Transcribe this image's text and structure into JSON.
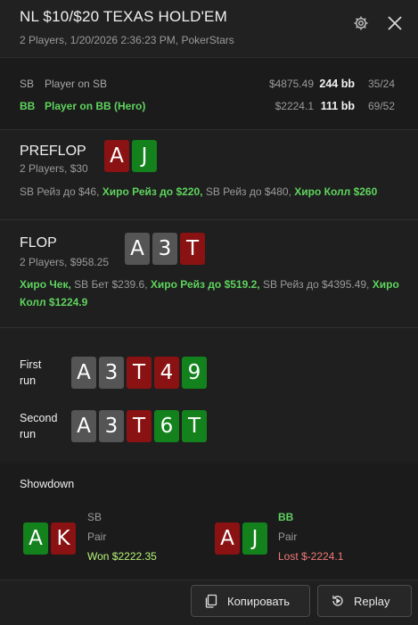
{
  "header": {
    "title": "NL $10/$20 TEXAS HOLD'EM",
    "subtitle": "2 Players, 1/20/2026 2:36:23 PM, PokerStars",
    "icons": [
      "gear-icon",
      "close-icon"
    ]
  },
  "players": [
    {
      "pos": "SB",
      "name": "Player on SB",
      "stack": "$4875.49",
      "bb": "244 bb",
      "stat": "35/24",
      "hero": false
    },
    {
      "pos": "BB",
      "name": "Player on BB (Hero)",
      "stack": "$2224.1",
      "bb": "111 bb",
      "stat": "69/52",
      "hero": true
    }
  ],
  "preflop": {
    "name": "PREFLOP",
    "sub": "2 Players, $30",
    "cards": [
      {
        "rank": "A",
        "color": "red"
      },
      {
        "rank": "J",
        "color": "green"
      }
    ],
    "actions": [
      {
        "text": "SB Рейз до $46,",
        "hero": false
      },
      {
        "text": "Хиро Рейз до $220,",
        "hero": true
      },
      {
        "text": "SB Рейз до $480,",
        "hero": false
      },
      {
        "text": "Хиро Колл $260",
        "hero": true
      }
    ]
  },
  "flop": {
    "name": "FLOP",
    "sub": "2 Players, $958.25",
    "cards": [
      {
        "rank": "A",
        "color": "gray"
      },
      {
        "rank": "3",
        "color": "gray"
      },
      {
        "rank": "T",
        "color": "red"
      }
    ],
    "actions": [
      {
        "text": "Хиро Чек,",
        "hero": true
      },
      {
        "text": "SB Бет $239.6,",
        "hero": false
      },
      {
        "text": "Хиро Рейз до $519.2,",
        "hero": true
      },
      {
        "text": "SB Рейз до $4395.49,",
        "hero": false
      },
      {
        "text": "Хиро Колл $1224.9",
        "hero": true
      }
    ]
  },
  "runs": [
    {
      "label_line1": "First",
      "label_line2": "run",
      "cards": [
        {
          "rank": "A",
          "color": "gray"
        },
        {
          "rank": "3",
          "color": "gray"
        },
        {
          "rank": "T",
          "color": "red"
        },
        {
          "rank": "4",
          "color": "red"
        },
        {
          "rank": "9",
          "color": "green"
        }
      ]
    },
    {
      "label_line1": "Second",
      "label_line2": "run",
      "cards": [
        {
          "rank": "A",
          "color": "gray"
        },
        {
          "rank": "3",
          "color": "gray"
        },
        {
          "rank": "T",
          "color": "red"
        },
        {
          "rank": "6",
          "color": "green"
        },
        {
          "rank": "T",
          "color": "green"
        }
      ]
    }
  ],
  "showdown": {
    "title": "Showdown",
    "hands": [
      {
        "cards": [
          {
            "rank": "A",
            "color": "green"
          },
          {
            "rank": "K",
            "color": "red"
          }
        ],
        "pos": "SB",
        "hand": "Pair",
        "result": "Won $2222.35",
        "won": true,
        "hero": false
      },
      {
        "cards": [
          {
            "rank": "A",
            "color": "red"
          },
          {
            "rank": "J",
            "color": "green"
          }
        ],
        "pos": "BB",
        "hand": "Pair",
        "result": "Lost $-2224.1",
        "won": false,
        "hero": true
      }
    ]
  },
  "footer": {
    "copy_label": "Копировать",
    "replay_label": "Replay"
  },
  "colors": {
    "red": "#8a1212",
    "green": "#13821d",
    "gray": "#555555",
    "hero": "#5fd35f",
    "won": "#b7f27a",
    "lost": "#f27a7a"
  }
}
